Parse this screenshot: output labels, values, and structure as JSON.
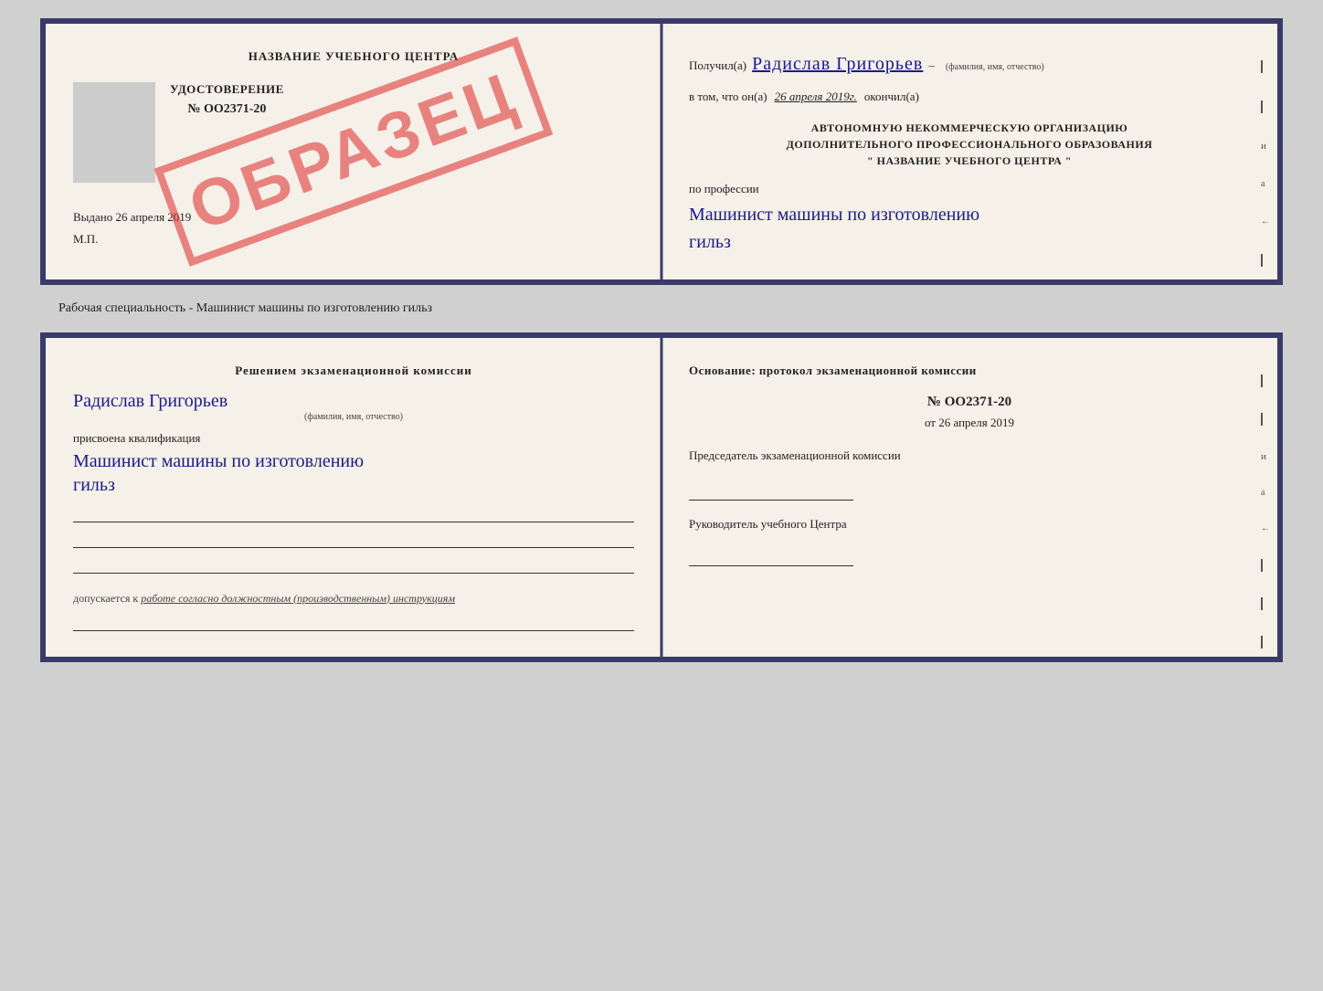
{
  "top_card": {
    "left": {
      "title": "НАЗВАНИЕ УЧЕБНОГО ЦЕНТРА",
      "udostoverenie_label": "УДОСТОВЕРЕНИЕ",
      "number": "№ OO2371-20",
      "vydano": "Выдано",
      "vydano_date": "26 апреля 2019",
      "mp": "М.П.",
      "stamp": "ОБРАЗЕЦ"
    },
    "right": {
      "poluchil_label": "Получил(а)",
      "name": "Радислав Григорьев",
      "fio_subtitle": "(фамилия, имя, отчество)",
      "dash": "–",
      "vtom_label": "в том, что он(а)",
      "date": "26 апреля 2019г.",
      "okonchil_label": "окончил(а)",
      "org_line1": "АВТОНОМНУЮ НЕКОММЕРЧЕСКУЮ ОРГАНИЗАЦИЮ",
      "org_line2": "ДОПОЛНИТЕЛЬНОГО ПРОФЕССИОНАЛЬНОГО ОБРАЗОВАНИЯ",
      "org_name": "\" НАЗВАНИЕ УЧЕБНОГО ЦЕНТРА \"",
      "po_professii_label": "по профессии",
      "profession_line1": "Машинист машины по изготовлению",
      "profession_line2": "гильз"
    }
  },
  "separator": {
    "text": "Рабочая специальность - Машинист машины по изготовлению гильз"
  },
  "bottom_card": {
    "left": {
      "resheniem_title": "Решением  экзаменационной  комиссии",
      "name": "Радислав Григорьев",
      "fio_subtitle": "(фамилия, имя, отчество)",
      "prisvoena_label": "присвоена квалификация",
      "kvalif_line1": "Машинист машины по изготовлению",
      "kvalif_line2": "гильз",
      "dopuskaetsya_label": "допускается к",
      "dopuskaetsya_italic": "работе согласно должностным (производственным) инструкциям"
    },
    "right": {
      "osnovanie_title": "Основание: протокол экзаменационной  комиссии",
      "number": "№  OO2371-20",
      "date_prefix": "от",
      "date": "26 апреля 2019",
      "predsedatel_label": "Председатель экзаменационной комиссии",
      "rukovoditel_label": "Руководитель учебного Центра"
    }
  }
}
